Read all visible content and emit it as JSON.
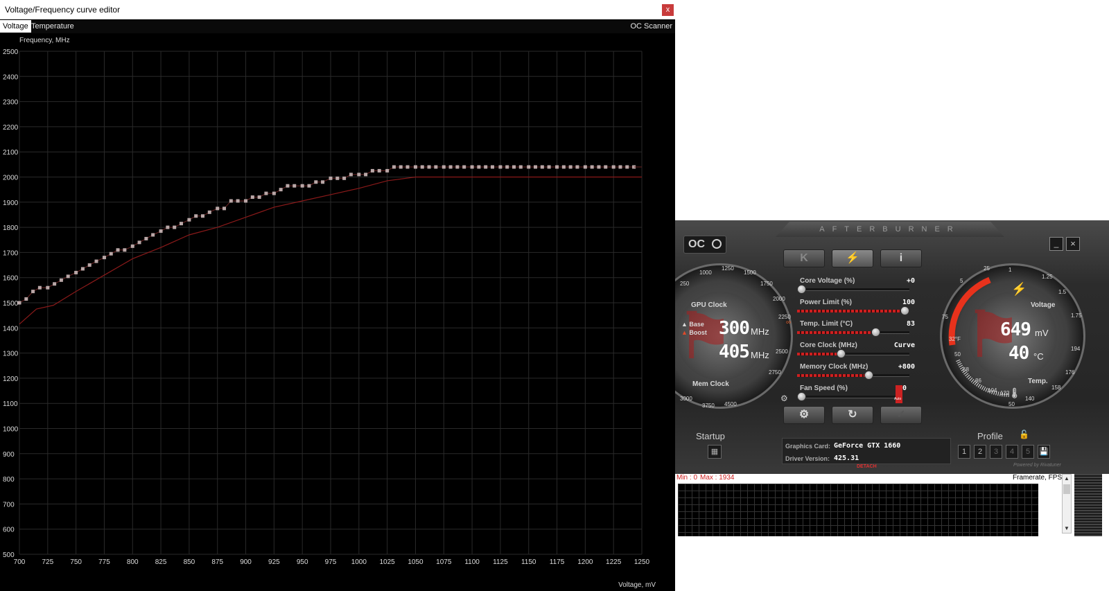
{
  "editor": {
    "title": "Voltage/Frequency curve editor",
    "close_label": "x",
    "tabs": [
      {
        "label": "Voltage"
      },
      {
        "label": "Temperature"
      }
    ],
    "oc_scanner_label": "OC Scanner",
    "y_axis_label": "Frequency, MHz",
    "x_axis_label": "Voltage, mV"
  },
  "chart_data": {
    "type": "line",
    "xlabel": "Voltage, mV",
    "ylabel": "Frequency, MHz",
    "xlim": [
      700,
      1250
    ],
    "ylim": [
      500,
      2500
    ],
    "x_ticks": [
      "700",
      "725",
      "750",
      "775",
      "800",
      "825",
      "850",
      "875",
      "900",
      "925",
      "950",
      "975",
      "1000",
      "1025",
      "1050",
      "1075",
      "1100",
      "1125",
      "1150",
      "1175",
      "1200",
      "1225",
      "1250"
    ],
    "y_ticks": [
      "2500",
      "2400",
      "2300",
      "2200",
      "2100",
      "2000",
      "1900",
      "1800",
      "1700",
      "1600",
      "1500",
      "1400",
      "1300",
      "1200",
      "1100",
      "1000",
      "900",
      "800",
      "700",
      "600",
      "500"
    ],
    "grid": true,
    "series": [
      {
        "role": "curve-points",
        "color": "#b9a7a7",
        "x": [
          700,
          706,
          712,
          718,
          725,
          731,
          737,
          743,
          750,
          756,
          762,
          768,
          775,
          781,
          787,
          793,
          800,
          806,
          812,
          818,
          825,
          831,
          837,
          843,
          850,
          856,
          862,
          868,
          875,
          881,
          887,
          893,
          900,
          906,
          912,
          918,
          925,
          931,
          937,
          943,
          950,
          956,
          962,
          968,
          975,
          981,
          987,
          993,
          1000,
          1006,
          1012,
          1018,
          1025,
          1031,
          1037,
          1043,
          1050,
          1056,
          1062,
          1068,
          1075,
          1081,
          1087,
          1093,
          1100,
          1106,
          1112,
          1118,
          1125,
          1131,
          1137,
          1143,
          1150,
          1156,
          1162,
          1168,
          1175,
          1181,
          1187,
          1193,
          1200,
          1206,
          1212,
          1218,
          1225,
          1231,
          1237,
          1243
        ],
        "y": [
          1500,
          1515,
          1545,
          1560,
          1560,
          1575,
          1590,
          1605,
          1620,
          1635,
          1650,
          1665,
          1680,
          1695,
          1710,
          1710,
          1725,
          1740,
          1755,
          1770,
          1785,
          1800,
          1800,
          1815,
          1830,
          1845,
          1845,
          1860,
          1875,
          1875,
          1905,
          1905,
          1905,
          1920,
          1920,
          1935,
          1935,
          1950,
          1965,
          1965,
          1965,
          1965,
          1980,
          1980,
          1995,
          1995,
          1995,
          2010,
          2010,
          2010,
          2025,
          2025,
          2025,
          2040,
          2040,
          2040,
          2040,
          2040,
          2040,
          2040,
          2040,
          2040,
          2040,
          2040,
          2040,
          2040,
          2040,
          2040,
          2040,
          2040,
          2040,
          2040,
          2040,
          2040,
          2040,
          2040,
          2040,
          2040,
          2040,
          2040,
          2040,
          2040,
          2040,
          2040,
          2040,
          2040,
          2040,
          2040
        ]
      },
      {
        "role": "base-curve",
        "color": "#8b1a1a",
        "x": [
          700,
          715,
          730,
          750,
          775,
          800,
          825,
          850,
          875,
          900,
          925,
          950,
          975,
          1000,
          1025,
          1050,
          1100,
          1150,
          1200,
          1250
        ],
        "y": [
          1415,
          1475,
          1490,
          1545,
          1610,
          1675,
          1720,
          1770,
          1800,
          1840,
          1880,
          1905,
          1930,
          1955,
          1985,
          2000,
          2000,
          2000,
          2000,
          2000
        ]
      }
    ]
  },
  "afterburner": {
    "brand": "AFTERBURNER",
    "oc_button": "OC",
    "minimize_label": "_",
    "close_label": "×",
    "gpu_clock_label": "GPU Clock",
    "mem_clock_label": "Mem Clock",
    "legend_base": "Base",
    "legend_boost": "Boost",
    "base_clock": "300",
    "boost_clock": "405",
    "clock_unit": "MHz",
    "left_ticks": [
      "250",
      "1000",
      "1250",
      "1500",
      "1750",
      "2000",
      "2250",
      "2500",
      "2750",
      "3000",
      "3750",
      "4500"
    ],
    "right_ticks": [
      "1",
      "1.25",
      "1.5",
      "1.75",
      "194",
      "176",
      "158",
      "140",
      "50",
      "122",
      "104",
      "86",
      "68",
      "50",
      "32°F"
    ],
    "voltage_label": "Voltage",
    "temp_label": "Temp.",
    "voltage_value": "649",
    "voltage_unit": "mV",
    "temp_value": "40",
    "temp_unit": "°C",
    "right_outer_ticks": [
      "25",
      "5",
      "75"
    ],
    "sliders": [
      {
        "label": "Core Voltage (%)",
        "value": "+0",
        "level": 0
      },
      {
        "label": "Power Limit (%)",
        "value": "100",
        "level": 1
      },
      {
        "label": "Temp. Limit (°C)",
        "value": "83",
        "level": 0.72
      },
      {
        "label": "Core Clock (MHz)",
        "value": "Curve",
        "level": 0.38
      },
      {
        "label": "Memory Clock (MHz)",
        "value": "+800",
        "level": 0.65
      },
      {
        "label": "Fan Speed (%)",
        "value": "0",
        "level": 0
      }
    ],
    "fan_auto_label": "Auto",
    "startup_label": "Startup",
    "profile_label": "Profile",
    "profile_slots": [
      "1",
      "2",
      "3",
      "4",
      "5"
    ],
    "graphics_card_key": "Graphics Card:",
    "graphics_card_value": "GeForce GTX 1660",
    "driver_key": "Driver Version:",
    "driver_value": "425.31",
    "detach_label": "DETACH",
    "powered_by": "Powered by Rivatuner",
    "monitor": {
      "min_text": "Min : 0",
      "max_text": "Max : 1934",
      "title": "Framerate, FPS"
    }
  }
}
